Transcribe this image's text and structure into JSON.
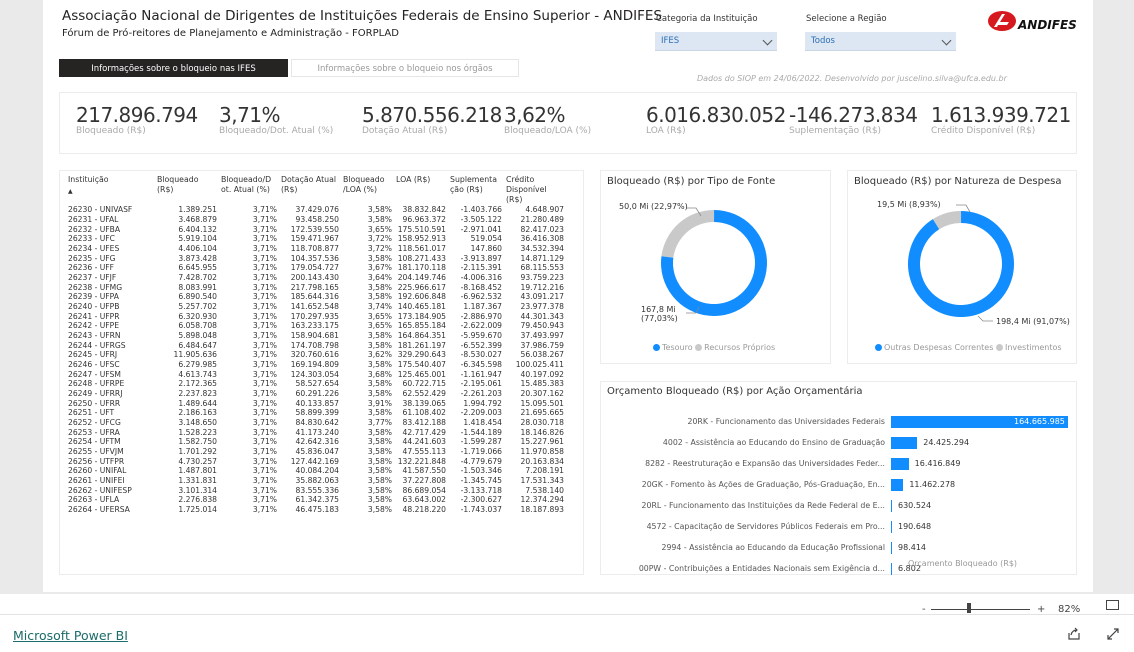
{
  "header": {
    "title": "Associação Nacional de Dirigentes de Instituições Federais de Ensino Superior - ANDIFES",
    "subtitle": "Fórum de Pró-reitores de Planejamento e Administração - FORPLAD"
  },
  "tabs": [
    {
      "label": "Informações sobre o bloqueio nas IFES",
      "active": true
    },
    {
      "label": "Informações sobre o bloqueio nos órgãos",
      "active": false
    }
  ],
  "filters": {
    "categoria_label": "Categoria da Instituição",
    "categoria_value": "IFES",
    "regiao_label": "Selecione a Região",
    "regiao_value": "Todos"
  },
  "logo": {
    "text": "ANDIFES",
    "color": "#d6181f"
  },
  "note": "Dados do SIOP em 24/06/2022. Desenvolvido por juscelino.silva@ufca.edu.br",
  "kpis": [
    {
      "value": "217.896.794",
      "label": "Bloqueado (R$)"
    },
    {
      "value": "3,71%",
      "label": "Bloqueado/Dot. Atual (%)"
    },
    {
      "value": "5.870.556.218",
      "label": "Dotação Atual (R$)"
    },
    {
      "value": "3,62%",
      "label": "Bloqueado/LOA (%)"
    },
    {
      "value": "6.016.830.052",
      "label": "LOA (R$)"
    },
    {
      "value": "-146.273.834",
      "label": "Suplementação (R$)"
    },
    {
      "value": "1.613.939.721",
      "label": "Crédito Disponível (R$)"
    }
  ],
  "table": {
    "headers": [
      "Instituição",
      "Bloqueado (R$)",
      "Bloqueado/D ot. Atual (%)",
      "Dotação Atual (R$)",
      "Bloqueado /LOA (%)",
      "LOA (R$)",
      "Suplementa ção (R$)",
      "Crédito Disponível (R$)"
    ],
    "rows": [
      [
        "26230 - UNIVASF",
        "1.389.251",
        "3,71%",
        "37.429.076",
        "3,58%",
        "38.832.842",
        "-1.403.766",
        "4.648.907"
      ],
      [
        "26231 - UFAL",
        "3.468.879",
        "3,71%",
        "93.458.250",
        "3,58%",
        "96.963.372",
        "-3.505.122",
        "21.280.489"
      ],
      [
        "26232 - UFBA",
        "6.404.132",
        "3,71%",
        "172.539.550",
        "3,65%",
        "175.510.591",
        "-2.971.041",
        "82.417.023"
      ],
      [
        "26233 - UFC",
        "5.919.104",
        "3,71%",
        "159.471.967",
        "3,72%",
        "158.952.913",
        "519.054",
        "36.416.308"
      ],
      [
        "26234 - UFES",
        "4.406.104",
        "3,71%",
        "118.708.877",
        "3,72%",
        "118.561.017",
        "147.860",
        "34.532.394"
      ],
      [
        "26235 - UFG",
        "3.873.428",
        "3,71%",
        "104.357.536",
        "3,58%",
        "108.271.433",
        "-3.913.897",
        "14.871.129"
      ],
      [
        "26236 - UFF",
        "6.645.955",
        "3,71%",
        "179.054.727",
        "3,67%",
        "181.170.118",
        "-2.115.391",
        "68.115.553"
      ],
      [
        "26237 - UFJF",
        "7.428.702",
        "3,71%",
        "200.143.430",
        "3,64%",
        "204.149.746",
        "-4.006.316",
        "93.759.223"
      ],
      [
        "26238 - UFMG",
        "8.083.991",
        "3,71%",
        "217.798.165",
        "3,58%",
        "225.966.617",
        "-8.168.452",
        "19.712.216"
      ],
      [
        "26239 - UFPA",
        "6.890.540",
        "3,71%",
        "185.644.316",
        "3,58%",
        "192.606.848",
        "-6.962.532",
        "43.091.217"
      ],
      [
        "26240 - UFPB",
        "5.257.702",
        "3,71%",
        "141.652.548",
        "3,74%",
        "140.465.181",
        "1.187.367",
        "23.977.378"
      ],
      [
        "26241 - UFPR",
        "6.320.930",
        "3,71%",
        "170.297.935",
        "3,65%",
        "173.184.905",
        "-2.886.970",
        "44.301.343"
      ],
      [
        "26242 - UFPE",
        "6.058.708",
        "3,71%",
        "163.233.175",
        "3,65%",
        "165.855.184",
        "-2.622.009",
        "79.450.943"
      ],
      [
        "26243 - UFRN",
        "5.898.048",
        "3,71%",
        "158.904.681",
        "3,58%",
        "164.864.351",
        "-5.959.670",
        "37.493.997"
      ],
      [
        "26244 - UFRGS",
        "6.484.647",
        "3,71%",
        "174.708.798",
        "3,58%",
        "181.261.197",
        "-6.552.399",
        "37.986.759"
      ],
      [
        "26245 - UFRJ",
        "11.905.636",
        "3,71%",
        "320.760.616",
        "3,62%",
        "329.290.643",
        "-8.530.027",
        "56.038.267"
      ],
      [
        "26246 - UFSC",
        "6.279.985",
        "3,71%",
        "169.194.809",
        "3,58%",
        "175.540.407",
        "-6.345.598",
        "100.025.411"
      ],
      [
        "26247 - UFSM",
        "4.613.743",
        "3,71%",
        "124.303.054",
        "3,68%",
        "125.465.001",
        "-1.161.947",
        "40.197.092"
      ],
      [
        "26248 - UFRPE",
        "2.172.365",
        "3,71%",
        "58.527.654",
        "3,58%",
        "60.722.715",
        "-2.195.061",
        "15.485.383"
      ],
      [
        "26249 - UFRRJ",
        "2.237.823",
        "3,71%",
        "60.291.226",
        "3,58%",
        "62.552.429",
        "-2.261.203",
        "20.307.162"
      ],
      [
        "26250 - UFRR",
        "1.489.644",
        "3,71%",
        "40.133.857",
        "3,91%",
        "38.139.065",
        "1.994.792",
        "15.095.501"
      ],
      [
        "26251 - UFT",
        "2.186.163",
        "3,71%",
        "58.899.399",
        "3,58%",
        "61.108.402",
        "-2.209.003",
        "21.695.665"
      ],
      [
        "26252 - UFCG",
        "3.148.650",
        "3,71%",
        "84.830.642",
        "3,77%",
        "83.412.188",
        "1.418.454",
        "28.030.718"
      ],
      [
        "26253 - UFRA",
        "1.528.223",
        "3,71%",
        "41.173.240",
        "3,58%",
        "42.717.429",
        "-1.544.189",
        "18.146.826"
      ],
      [
        "26254 - UFTM",
        "1.582.750",
        "3,71%",
        "42.642.316",
        "3,58%",
        "44.241.603",
        "-1.599.287",
        "15.227.961"
      ],
      [
        "26255 - UFVJM",
        "1.701.292",
        "3,71%",
        "45.836.047",
        "3,58%",
        "47.555.113",
        "-1.719.066",
        "11.970.858"
      ],
      [
        "26256 - UTFPR",
        "4.730.257",
        "3,71%",
        "127.442.169",
        "3,58%",
        "132.221.848",
        "-4.779.679",
        "20.163.834"
      ],
      [
        "26260 - UNIFAL",
        "1.487.801",
        "3,71%",
        "40.084.204",
        "3,58%",
        "41.587.550",
        "-1.503.346",
        "7.208.191"
      ],
      [
        "26261 - UNIFEI",
        "1.331.831",
        "3,71%",
        "35.882.063",
        "3,58%",
        "37.227.808",
        "-1.345.745",
        "17.531.343"
      ],
      [
        "26262 - UNIFESP",
        "3.101.314",
        "3,71%",
        "83.555.336",
        "3,58%",
        "86.689.054",
        "-3.133.718",
        "7.538.140"
      ],
      [
        "26263 - UFLA",
        "2.276.838",
        "3,71%",
        "61.342.375",
        "3,58%",
        "63.643.002",
        "-2.300.627",
        "12.374.294"
      ],
      [
        "26264 - UFERSA",
        "1.725.014",
        "3,71%",
        "46.475.183",
        "3,58%",
        "48.218.220",
        "-1.743.037",
        "18.187.893"
      ]
    ]
  },
  "donut_fonte": {
    "title": "Bloqueado (R$) por Tipo de Fonte",
    "labels": [
      "167,8 Mi (77,03%)",
      "50,0 Mi (22,97%)"
    ],
    "legend": [
      "Tesouro",
      "Recursos Próprios"
    ],
    "values": [
      77.03,
      22.97
    ],
    "colors": [
      "#118dff",
      "#c9c9c9"
    ]
  },
  "donut_natureza": {
    "title": "Bloqueado (R$) por Natureza de Despesa",
    "labels": [
      "198,4 Mi (91,07%)",
      "19,5 Mi (8,93%)"
    ],
    "legend": [
      "Outras Despesas Correntes",
      "Investimentos"
    ],
    "values": [
      91.07,
      8.93
    ],
    "colors": [
      "#118dff",
      "#c9c9c9"
    ]
  },
  "chart_data": {
    "type": "bar",
    "title": "Orçamento Bloqueado (R$) por Ação Orçamentária",
    "xlabel": "Orçamento Bloqueado (R$)",
    "categories": [
      "20RK - Funcionamento das Universidades Federais",
      "4002 - Assistência ao Educando do Ensino de Graduação",
      "8282 - Reestruturação e Expansão das Universidades Feder...",
      "20GK - Fomento às Ações de Graduação, Pós-Graduação, En...",
      "20RL - Funcionamento das Instituições da Rede Federal de E...",
      "4572 - Capacitação de Servidores Públicos Federais em Pro...",
      "2994 - Assistência ao Educando da Educação Profissional",
      "00PW - Contribuições a Entidades Nacionais sem Exigência d..."
    ],
    "values": [
      164665985,
      24425294,
      16416849,
      11462278,
      630524,
      190648,
      98414,
      6802
    ],
    "labels": [
      "164.665.985",
      "24.425.294",
      "16.416.849",
      "11.462.278",
      "630.524",
      "190.648",
      "98.414",
      "6.802"
    ]
  },
  "zoom": {
    "value": "82%",
    "minus": "-",
    "plus": "+"
  },
  "footer": {
    "brand": "Microsoft Power BI"
  }
}
